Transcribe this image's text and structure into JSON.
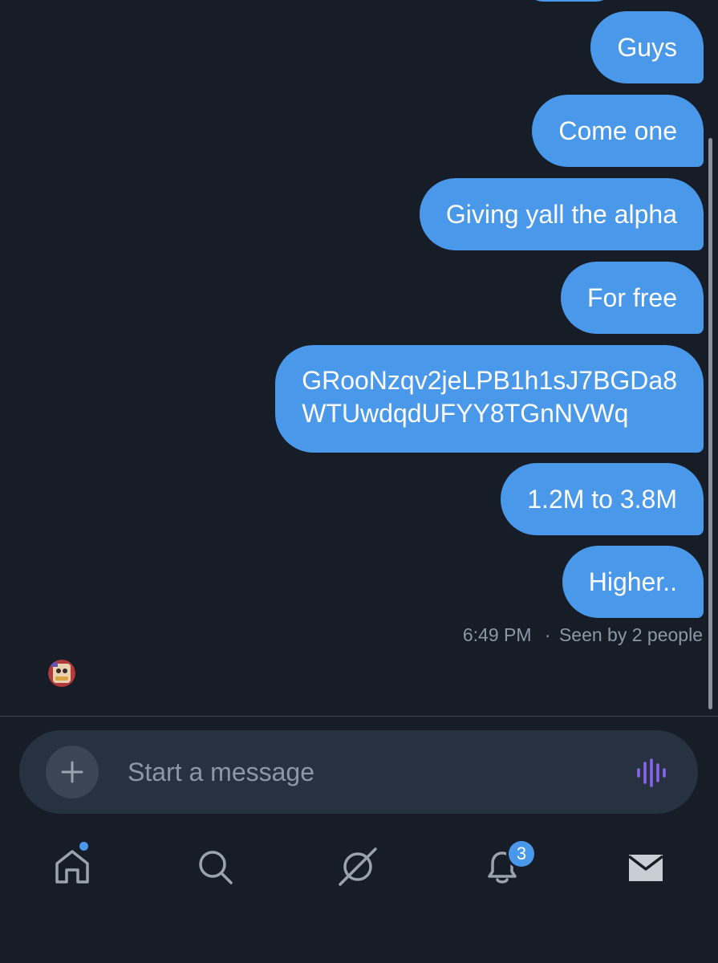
{
  "messages": [
    {
      "text": "Guys"
    },
    {
      "text": "Come one"
    },
    {
      "text": "Giving yall the alpha"
    },
    {
      "text": "For free"
    },
    {
      "text": "GRooNzqv2jeLPB1h1sJ7BGDa8\nWTUwdqdUFYY8TGnNVWq"
    },
    {
      "text": "1.2M to 3.8M"
    },
    {
      "text": "Higher.."
    }
  ],
  "meta": {
    "time": "6:49 PM",
    "separator": "·",
    "seen": "Seen by 2 people"
  },
  "composer": {
    "placeholder": "Start a message",
    "plus_icon": "plus-icon",
    "voice_icon": "audio-waveform-icon"
  },
  "tabbar": {
    "items": [
      {
        "icon": "home-icon",
        "has_dot": true
      },
      {
        "icon": "search-icon"
      },
      {
        "icon": "grok-icon"
      },
      {
        "icon": "bell-icon",
        "badge": "3"
      },
      {
        "icon": "mail-icon"
      }
    ]
  },
  "colors": {
    "background": "#161d27",
    "bubble": "#4a98e9",
    "composer": "#263240",
    "muted_text": "#8b98a5",
    "voice_accent": "#8b63f0"
  }
}
